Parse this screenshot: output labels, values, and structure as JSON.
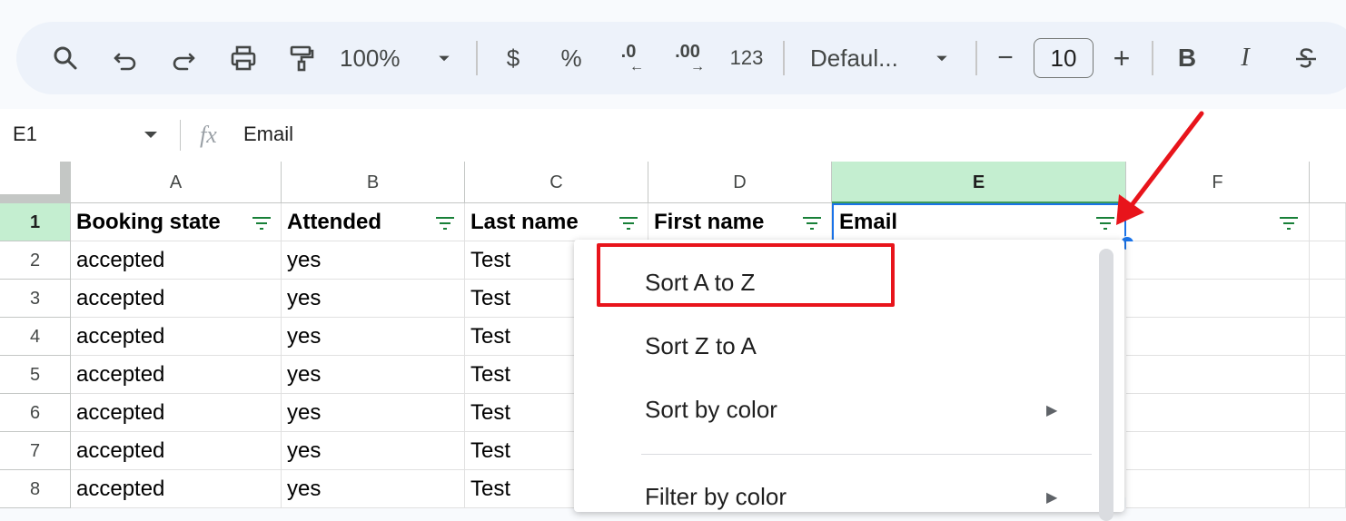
{
  "toolbar": {
    "zoom": "100%",
    "currency": "$",
    "percent": "%",
    "decrease_decimal": ".0",
    "increase_decimal": ".00",
    "number_format": "123",
    "font": "Defaul...",
    "minus": "−",
    "font_size": "10",
    "plus": "+",
    "bold": "B",
    "italic": "I"
  },
  "formula_bar": {
    "name_box": "E1",
    "fx": "fx",
    "content": "Email"
  },
  "columns": [
    "A",
    "B",
    "C",
    "D",
    "E",
    "F"
  ],
  "rows": [
    "1",
    "2",
    "3",
    "4",
    "5",
    "6",
    "7",
    "8"
  ],
  "headers": [
    "Booking state",
    "Attended",
    "Last name",
    "First name",
    "Email"
  ],
  "data_rows": [
    [
      "accepted",
      "yes",
      "Test"
    ],
    [
      "accepted",
      "yes",
      "Test"
    ],
    [
      "accepted",
      "yes",
      "Test"
    ],
    [
      "accepted",
      "yes",
      "Test"
    ],
    [
      "accepted",
      "yes",
      "Test"
    ],
    [
      "accepted",
      "yes",
      "Test"
    ],
    [
      "accepted",
      "yes",
      "Test"
    ]
  ],
  "menu": {
    "items": [
      "Sort A to Z",
      "Sort Z to A",
      "Sort by color",
      "Filter by color"
    ]
  },
  "colors": {
    "accent_red": "#e8141b",
    "selection_blue": "#1a73e8",
    "filter_green": "#188038",
    "selected_header": "#c4eed0"
  }
}
